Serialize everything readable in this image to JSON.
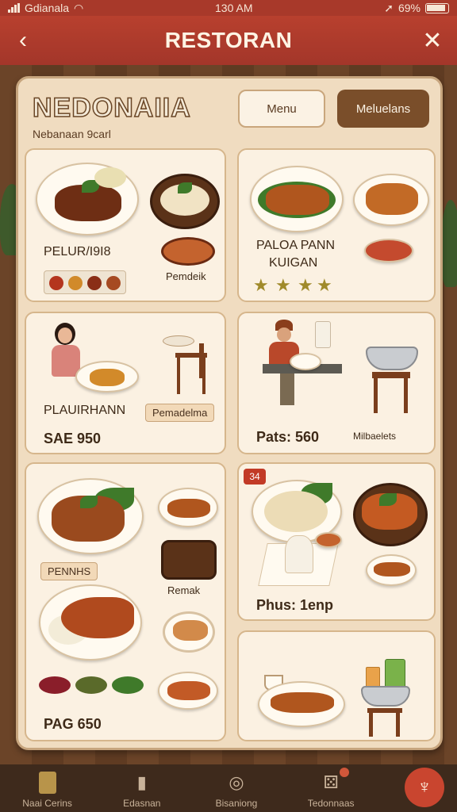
{
  "status_bar": {
    "carrier": "Gdianala",
    "time": "130 AM",
    "battery": "69%"
  },
  "header": {
    "title": "RESTORAN"
  },
  "panel": {
    "title": "NEDONAIIA",
    "subtitle": "Nebanaan 9carl",
    "tabs": [
      {
        "label": "Menu"
      },
      {
        "label": "Meluelans"
      }
    ]
  },
  "cards": [
    {
      "title": "PELUR/I9I8",
      "side_label": "Pemdeik"
    },
    {
      "title_line1": "PALOA PANN",
      "title_line2": "KUIGAN"
    },
    {
      "title": "PLAUIRHANN",
      "pill": "Pemadelma",
      "price": "SAE 950"
    },
    {
      "price": "Pats: 560",
      "side_label": "Milbaelets"
    },
    {
      "pill": "PENNHS",
      "side_label": "Remak",
      "price": "PAG 650"
    },
    {
      "badge": "34",
      "price": "Phus: 1enp"
    }
  ],
  "bottom_nav": [
    {
      "label": "Naai Cerins",
      "icon": "card-icon"
    },
    {
      "label": "Edasnan",
      "icon": "phone-icon"
    },
    {
      "label": "Bisaniong",
      "icon": "search-icon"
    },
    {
      "label": "Tedonnaas",
      "icon": "dice-icon"
    }
  ],
  "fab_icon": "chef-icon",
  "colors": {
    "header": "#a3362a",
    "panel": "#f0dcc0",
    "accent": "#7a4e2a",
    "nav": "#3e2a1c"
  }
}
